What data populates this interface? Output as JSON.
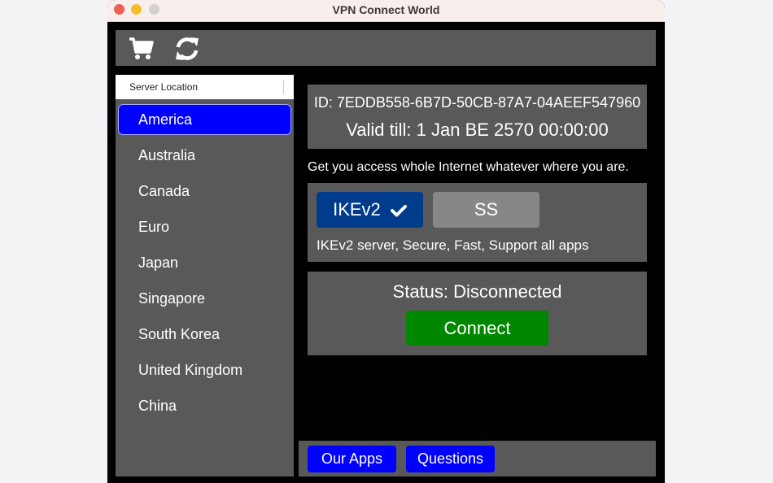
{
  "window": {
    "title": "VPN Connect World",
    "traffic_lights": [
      "close",
      "minimize",
      "maximize"
    ]
  },
  "toolbar": {
    "icons": [
      "cart-icon",
      "refresh-icon"
    ]
  },
  "sidebar": {
    "header": "Server Location",
    "items": [
      {
        "label": "America",
        "selected": true
      },
      {
        "label": "Australia",
        "selected": false
      },
      {
        "label": "Canada",
        "selected": false
      },
      {
        "label": "Euro",
        "selected": false
      },
      {
        "label": "Japan",
        "selected": false
      },
      {
        "label": "Singapore",
        "selected": false
      },
      {
        "label": "South Korea",
        "selected": false
      },
      {
        "label": "United Kingdom",
        "selected": false
      },
      {
        "label": "China",
        "selected": false
      }
    ]
  },
  "account": {
    "id_text": "ID: 7EDDB558-6B7D-50CB-87A7-04AEEF547960",
    "valid_text": "Valid till: 1 Jan BE 2570 00:00:00"
  },
  "tagline": "Get you access whole Internet whatever where you are.",
  "protocols": {
    "options": [
      {
        "label": "IKEv2",
        "selected": true
      },
      {
        "label": "SS",
        "selected": false
      }
    ],
    "description": "IKEv2 server, Secure, Fast, Support all apps"
  },
  "connection": {
    "status_text": "Status: Disconnected",
    "connect_label": "Connect"
  },
  "footer": {
    "our_apps_label": "Our Apps",
    "questions_label": "Questions"
  },
  "colors": {
    "panel_bg": "#595959",
    "selected_blue": "#0000ff",
    "ikev2_blue": "#003b8c",
    "ss_gray": "#878787",
    "connect_green": "#008700"
  }
}
